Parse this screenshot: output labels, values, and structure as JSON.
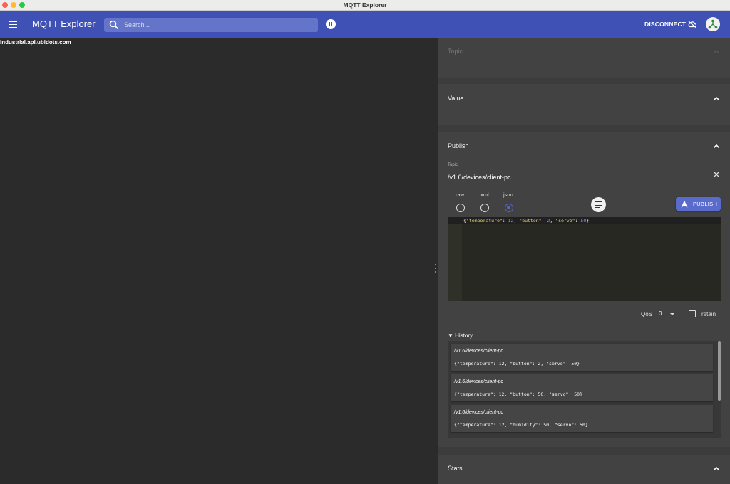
{
  "window": {
    "title": "MQTT Explorer"
  },
  "header": {
    "app_title": "MQTT Explorer",
    "search_placeholder": "Search...",
    "disconnect_label": "DISCONNECT",
    "accent_color": "#3f51b5"
  },
  "tree": {
    "root_node": "industrial.api.ubidots.com",
    "more_indicator": "..."
  },
  "panels": {
    "topic": {
      "title": "Topic"
    },
    "value": {
      "title": "Value"
    },
    "publish": {
      "title": "Publish",
      "topic_label": "Topic",
      "topic_value": "/v1.6/devices/client-pc",
      "formats": [
        "raw",
        "xml",
        "json"
      ],
      "selected_format": "json",
      "publish_label": "PUBLISH",
      "editor": {
        "tokens": [
          "{",
          "\"temperature\"",
          ": ",
          "12",
          ", ",
          "\"button\"",
          ": ",
          "2",
          ", ",
          "\"servo\"",
          ": ",
          "50",
          "}"
        ]
      },
      "qos_label": "QoS",
      "qos_value": "0",
      "retain_label": "retain",
      "retain_checked": false,
      "history_title": "▼ History",
      "history": [
        {
          "topic": "/v1.6/devices/client-pc",
          "payload": "{\"temperature\": 12, \"button\": 2, \"servo\": 50}"
        },
        {
          "topic": "/v1.6/devices/client-pc",
          "payload": "{\"temperature\": 12, \"button\": 50, \"servo\": 50}"
        },
        {
          "topic": "/v1.6/devices/client-pc",
          "payload": "{\"temperature\": 12, \"humidity\": 50, \"servo\": 50}"
        }
      ]
    },
    "stats": {
      "title": "Stats"
    }
  }
}
